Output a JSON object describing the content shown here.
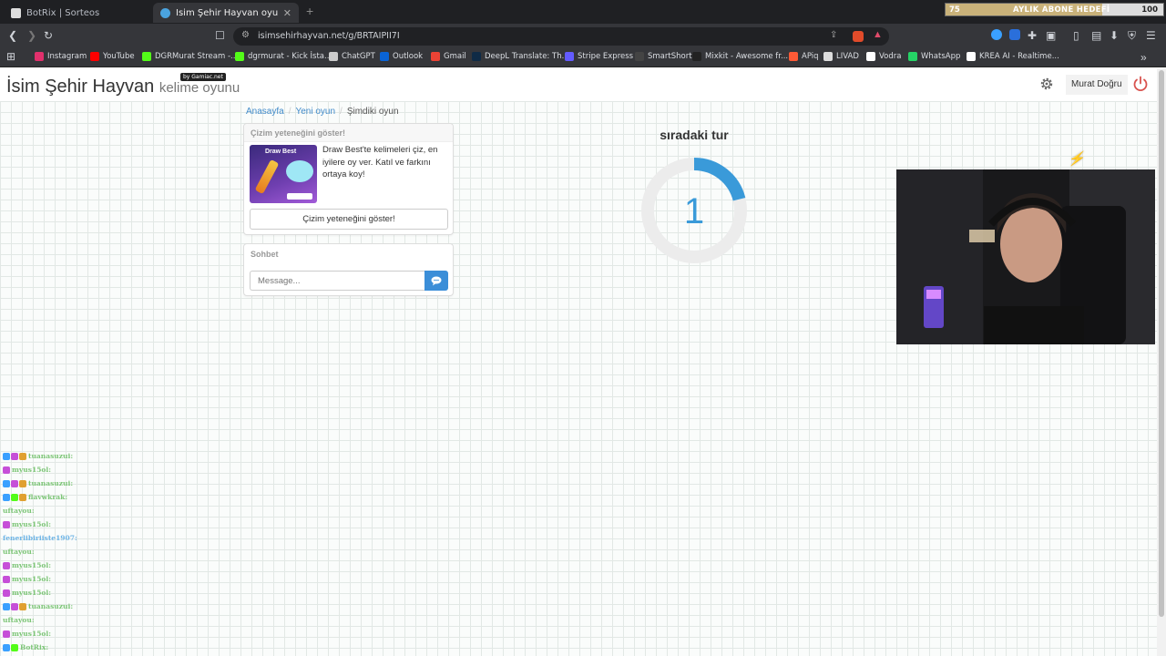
{
  "browser": {
    "tabs": [
      {
        "title": "BotRix | Sorteos",
        "active": false
      },
      {
        "title": "İsim Şehir Hayvan oyununa katıl",
        "active": true
      }
    ],
    "address": "isimsehirhayvan.net/g/BRTAIPII7I",
    "bookmarks": [
      {
        "label": "Instagram",
        "icon_color": "#e1306c"
      },
      {
        "label": "YouTube",
        "icon_color": "#ff0000"
      },
      {
        "label": "DGRMurat Stream -...",
        "icon_color": "#53fc18"
      },
      {
        "label": "dgrmurat - Kick İsta...",
        "icon_color": "#53fc18"
      },
      {
        "label": "ChatGPT",
        "icon_color": "#cccccc"
      },
      {
        "label": "Outlook",
        "icon_color": "#0a64d6"
      },
      {
        "label": "Gmail",
        "icon_color": "#ea4335"
      },
      {
        "label": "DeepL Translate: Th...",
        "icon_color": "#0f2b46"
      },
      {
        "label": "Stripe Express",
        "icon_color": "#635bff"
      },
      {
        "label": "SmartShort",
        "icon_color": "#444444"
      },
      {
        "label": "Mixkit - Awesome fr...",
        "icon_color": "#222222"
      },
      {
        "label": "APiq",
        "icon_color": "#ff5a36"
      },
      {
        "label": "LIVAD",
        "icon_color": "#dddddd"
      },
      {
        "label": "Vodra",
        "icon_color": "#ffffff"
      },
      {
        "label": "WhatsApp",
        "icon_color": "#25d366"
      },
      {
        "label": "KREA AI - Realtime...",
        "icon_color": "#ffffff"
      }
    ]
  },
  "goal_widget": {
    "current": "75",
    "label": "AYLIK ABONE HEDEFİ",
    "target": "100",
    "progress": 0.75
  },
  "site": {
    "title": "İsim Şehir Hayvan",
    "subtitle": "kelime oyunu",
    "badge": "by Gamiac.net",
    "user_name": "Murat Doğru"
  },
  "breadcrumb": [
    "Anasayfa",
    "Yeni oyun",
    "Şimdiki oyun"
  ],
  "promo": {
    "header": "Çizim yeteneğini göster!",
    "image_title": "Draw Best",
    "text": "Draw Best'te kelimeleri çiz, en iyilere oy ver. Katıl ve farkını ortaya koy!",
    "button": "Çizim yeteneğini göster!"
  },
  "chat": {
    "header": "Sohbet",
    "placeholder": "Message..."
  },
  "countdown": {
    "title": "sıradaki tur",
    "value": "1",
    "accent": "#3a9ad9"
  },
  "stream_overlay": [
    {
      "user": "tuanasuzui:",
      "badges": [
        "#3aa0ff",
        "#c64fd8",
        "#e0a030"
      ],
      "user_color": "#7cc576"
    },
    {
      "user": "myus15ol:",
      "badges": [
        "#c64fd8"
      ],
      "user_color": "#7cc576"
    },
    {
      "user": "tuanasuzui:",
      "badges": [
        "#3aa0ff",
        "#c64fd8",
        "#e0a030"
      ],
      "user_color": "#7cc576"
    },
    {
      "user": "flavwkrak:",
      "badges": [
        "#3aa0ff",
        "#53fc18",
        "#e0a030"
      ],
      "user_color": "#7cc576"
    },
    {
      "user": "uftayou:",
      "badges": [],
      "user_color": "#7cc576"
    },
    {
      "user": "myus15ol:",
      "badges": [
        "#c64fd8"
      ],
      "user_color": "#7cc576"
    },
    {
      "user": "fenerlibiriiste1907:",
      "badges": [],
      "user_color": "#6fb5e6"
    },
    {
      "user": "uftayou:",
      "badges": [],
      "user_color": "#7cc576"
    },
    {
      "user": "myus15ol:",
      "badges": [
        "#c64fd8"
      ],
      "user_color": "#7cc576"
    },
    {
      "user": "myus15ol:",
      "badges": [
        "#c64fd8"
      ],
      "user_color": "#7cc576"
    },
    {
      "user": "myus15ol:",
      "badges": [
        "#c64fd8"
      ],
      "user_color": "#7cc576"
    },
    {
      "user": "tuanasuzui:",
      "badges": [
        "#3aa0ff",
        "#c64fd8",
        "#e0a030"
      ],
      "user_color": "#7cc576"
    },
    {
      "user": "uftayou:",
      "badges": [],
      "user_color": "#7cc576"
    },
    {
      "user": "myus15ol:",
      "badges": [
        "#c64fd8"
      ],
      "user_color": "#7cc576"
    },
    {
      "user": "BotRix:",
      "badges": [
        "#3aa0ff",
        "#53fc18"
      ],
      "user_color": "#7cc576"
    },
    {
      "user": "excalibuer:",
      "badges": [
        "#e0a030"
      ],
      "user_color": "#7cc576"
    }
  ]
}
